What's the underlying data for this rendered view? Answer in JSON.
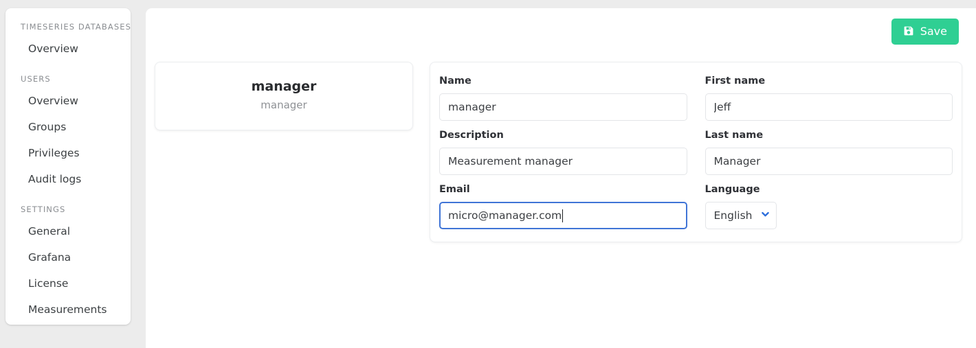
{
  "sidebar": {
    "sections": [
      {
        "title": "TIMESERIES DATABASES",
        "items": [
          {
            "label": "Overview"
          }
        ]
      },
      {
        "title": "USERS",
        "items": [
          {
            "label": "Overview"
          },
          {
            "label": "Groups"
          },
          {
            "label": "Privileges"
          },
          {
            "label": "Audit logs"
          }
        ]
      },
      {
        "title": "SETTINGS",
        "items": [
          {
            "label": "General"
          },
          {
            "label": "Grafana"
          },
          {
            "label": "License"
          },
          {
            "label": "Measurements"
          }
        ]
      }
    ]
  },
  "toolbar": {
    "save_label": "Save",
    "save_icon": "save-floppy-icon",
    "save_color": "#2fcf93"
  },
  "user_card": {
    "title": "manager",
    "subtitle": "manager"
  },
  "form": {
    "left": {
      "name": {
        "label": "Name",
        "value": "manager",
        "placeholder": "Name"
      },
      "description": {
        "label": "Description",
        "value": "Measurement manager",
        "placeholder": "Description"
      },
      "email": {
        "label": "Email",
        "value": "micro@manager.com",
        "placeholder": "Email",
        "focused": true,
        "focus_color": "#3f74d6"
      }
    },
    "right": {
      "first_name": {
        "label": "First name",
        "value": "Jeff",
        "placeholder": "First name"
      },
      "last_name": {
        "label": "Last name",
        "value": "Manager",
        "placeholder": "Last name"
      },
      "language": {
        "label": "Language",
        "value": "English",
        "chevron_icon": "chevron-down-icon",
        "chevron_color": "#2c6ddb"
      }
    }
  }
}
